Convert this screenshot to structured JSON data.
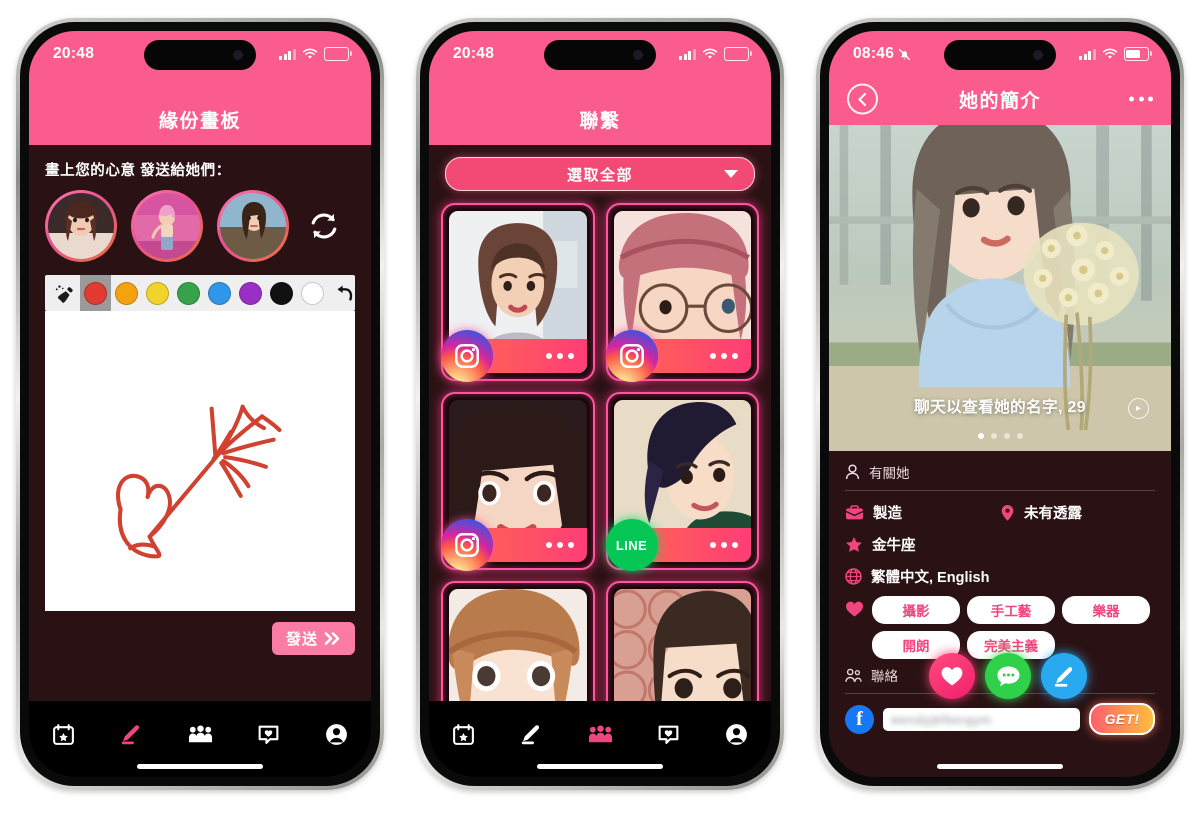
{
  "app": {
    "accent_pink": "#fa5c8e",
    "dark_bg": "#2a1214",
    "neon_pink": "#ff55a0"
  },
  "phone1": {
    "status": {
      "time": "20:48",
      "battery": "full",
      "wifi": "wifi-icon",
      "signal": "signal-icon"
    },
    "header": {
      "title": "緣份畫板"
    },
    "lead_text": "畫上您的心意 發送給她們：",
    "avatars": [
      {
        "name": "avatar-1"
      },
      {
        "name": "avatar-2"
      },
      {
        "name": "avatar-3"
      }
    ],
    "refresh_icon": "refresh-icon",
    "palette": {
      "brush_icon": "brush-icon",
      "undo_icon": "undo-icon",
      "selected_index": 0,
      "colors": [
        "#e03c31",
        "#f5a211",
        "#f2d32c",
        "#36a34a",
        "#2f96e8",
        "#9b2fc4",
        "#111111",
        "#ffffff"
      ]
    },
    "canvas": {
      "stroke_color": "#d1412f",
      "drawing": "heart-arrow-sketch"
    },
    "send_button": {
      "label": "發送",
      "chevron": "double-chevron-right-icon"
    },
    "tabs": [
      {
        "name": "calendar",
        "icon": "calendar-star-icon",
        "active": false
      },
      {
        "name": "draw",
        "icon": "pen-icon",
        "active": true
      },
      {
        "name": "people",
        "icon": "people-icon",
        "active": false
      },
      {
        "name": "likes",
        "icon": "heart-message-icon",
        "active": false
      },
      {
        "name": "profile",
        "icon": "person-circle-icon",
        "active": false
      }
    ]
  },
  "phone2": {
    "status": {
      "time": "20:48"
    },
    "header": {
      "title": "聯繫"
    },
    "select_all": {
      "label": "選取全部",
      "caret": "chevron-down-icon"
    },
    "cards": [
      {
        "badge": "instagram",
        "badge_label": "",
        "more": "ellipsis-icon"
      },
      {
        "badge": "instagram",
        "badge_label": "",
        "more": "ellipsis-icon"
      },
      {
        "badge": "instagram",
        "badge_label": "",
        "more": "ellipsis-icon"
      },
      {
        "badge": "line",
        "badge_label": "LINE",
        "more": "ellipsis-icon"
      },
      {
        "badge": "none",
        "badge_label": "",
        "more": ""
      },
      {
        "badge": "none",
        "badge_label": "",
        "more": ""
      }
    ],
    "tabs": [
      {
        "name": "calendar",
        "icon": "calendar-star-icon",
        "active": false
      },
      {
        "name": "draw",
        "icon": "pen-icon",
        "active": false
      },
      {
        "name": "people",
        "icon": "people-icon",
        "active": true
      },
      {
        "name": "likes",
        "icon": "heart-message-icon",
        "active": false
      },
      {
        "name": "profile",
        "icon": "person-circle-icon",
        "active": false
      }
    ]
  },
  "phone3": {
    "status": {
      "time": "08:46",
      "mute_icon": "bell-muted-icon"
    },
    "header": {
      "title": "她的簡介",
      "back": "back-chevron-icon",
      "more": "ellipsis-icon"
    },
    "hero": {
      "name_line": "聊天以查看她的名字, 29",
      "info_icon": "info-circle-icon",
      "dot_count": 4,
      "active_dot": 0
    },
    "about": {
      "section_label": "有關她",
      "icon": "person-icon"
    },
    "facts": [
      {
        "icon": "briefcase-icon",
        "label": "製造"
      },
      {
        "icon": "location-pin-icon",
        "label": "未有透露"
      },
      {
        "icon": "star-icon",
        "label": "金牛座"
      },
      {
        "icon": "globe-icon",
        "label": "繁體中文, English"
      }
    ],
    "interests": {
      "icon": "heart-icon",
      "tags": [
        "攝影",
        "手工藝",
        "樂器",
        "開朗",
        "完美主義"
      ]
    },
    "contact": {
      "label": "聯絡",
      "icon": "people-icon",
      "buttons": [
        {
          "name": "like-button",
          "icon": "heart-icon"
        },
        {
          "name": "message-button",
          "icon": "chat-bubble-icon"
        },
        {
          "name": "draw-button",
          "icon": "pen-icon"
        }
      ]
    },
    "facebook": {
      "icon": "facebook-icon",
      "value": "wendyjkfbergym",
      "get_label": "GET!"
    }
  }
}
